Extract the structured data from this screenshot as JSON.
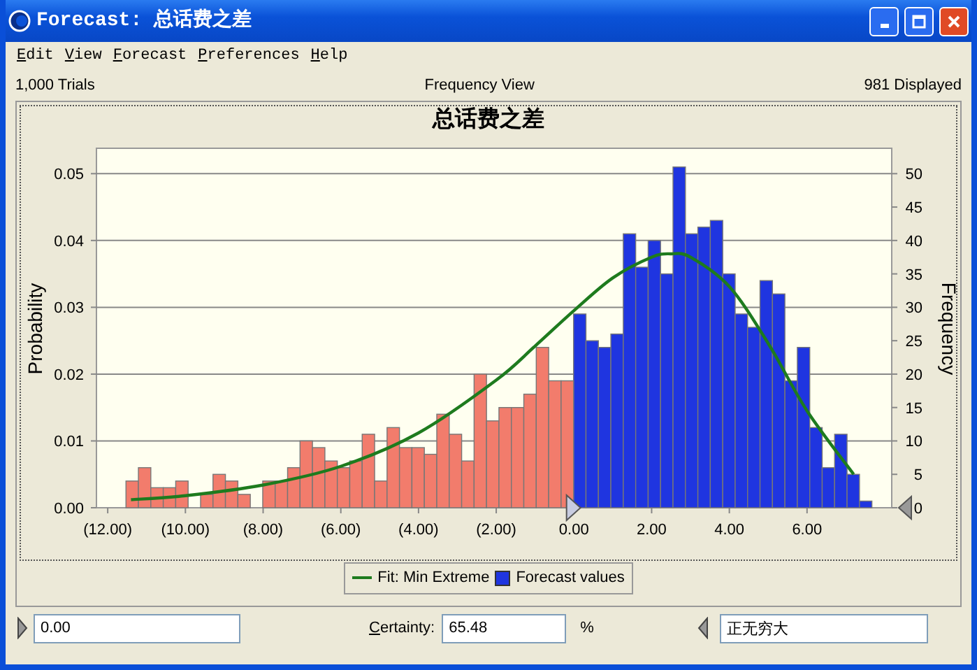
{
  "window": {
    "title": "Forecast: 总话费之差"
  },
  "menu": [
    {
      "label": "Edit"
    },
    {
      "label": "View"
    },
    {
      "label": "Forecast"
    },
    {
      "label": "Preferences"
    },
    {
      "label": "Help"
    }
  ],
  "info_bar": {
    "trials": "1,000 Trials",
    "view": "Frequency View",
    "displayed": "981 Displayed"
  },
  "chart": {
    "chart_data": {
      "type": "bar",
      "grid": true,
      "title": "总话费之差",
      "ylabel": "Probability",
      "y2label": "Frequency",
      "x": [
        -11.37,
        -11.05,
        -10.73,
        -10.41,
        -10.09,
        -9.77,
        -9.45,
        -9.13,
        -8.81,
        -8.49,
        -8.17,
        -7.85,
        -7.53,
        -7.21,
        -6.89,
        -6.57,
        -6.25,
        -5.93,
        -5.61,
        -5.29,
        -4.97,
        -4.65,
        -4.33,
        -4.01,
        -3.69,
        -3.37,
        -3.05,
        -2.73,
        -2.41,
        -2.09,
        -1.77,
        -1.45,
        -1.13,
        -0.81,
        -0.49,
        -0.17,
        0.15,
        0.47,
        0.79,
        1.11,
        1.43,
        1.75,
        2.07,
        2.39,
        2.71,
        3.03,
        3.35,
        3.67,
        3.99,
        4.31,
        4.63,
        4.95,
        5.27,
        5.59,
        5.91,
        6.23,
        6.55,
        6.87,
        7.19,
        7.51
      ],
      "series": [
        {
          "name": "Fit: Min Extreme",
          "type": "line",
          "color": "#1e7b1e",
          "x": [
            -11.4,
            -10,
            -8,
            -6,
            -4,
            -2,
            -1,
            0,
            1,
            2,
            2.5,
            3,
            4,
            5,
            6,
            7.2
          ],
          "values": [
            0.0012,
            0.0018,
            0.0034,
            0.0062,
            0.0112,
            0.0191,
            0.0242,
            0.0295,
            0.0344,
            0.0375,
            0.038,
            0.0375,
            0.0331,
            0.0246,
            0.0145,
            0.005
          ]
        },
        {
          "name": "Forecast values",
          "color": "#1f35e0",
          "values": [
            null,
            null,
            null,
            null,
            null,
            null,
            null,
            null,
            null,
            null,
            null,
            null,
            null,
            null,
            null,
            null,
            null,
            null,
            null,
            null,
            null,
            null,
            null,
            null,
            null,
            null,
            null,
            null,
            null,
            null,
            null,
            null,
            null,
            null,
            null,
            null,
            0.029,
            0.025,
            0.024,
            0.026,
            0.041,
            0.036,
            0.04,
            0.035,
            0.051,
            0.041,
            0.042,
            0.043,
            0.035,
            0.029,
            0.027,
            0.034,
            0.032,
            0.019,
            0.024,
            0.012,
            0.006,
            0.011,
            0.005,
            0.001
          ]
        },
        {
          "color": "#f27c6c",
          "values": [
            0.004,
            0.006,
            0.003,
            0.003,
            0.004,
            null,
            0.002,
            0.005,
            0.004,
            0.002,
            null,
            0.004,
            0.004,
            0.006,
            0.01,
            0.009,
            0.007,
            0.006,
            0.007,
            0.011,
            0.004,
            0.012,
            0.009,
            0.009,
            0.008,
            0.014,
            0.011,
            0.007,
            0.02,
            0.013,
            0.015,
            0.015,
            0.017,
            0.024,
            0.019,
            0.019,
            null,
            null,
            null,
            null,
            null,
            null,
            null,
            null,
            null,
            null,
            null,
            null,
            null,
            null,
            null,
            null,
            null,
            null,
            null,
            null,
            null,
            null,
            null,
            null
          ]
        }
      ],
      "xlim": [
        -12.29,
        8.18
      ],
      "ylim": [
        0,
        0.0538
      ],
      "y2lim": [
        0,
        53.8
      ],
      "xticks": [
        {
          "value": -12,
          "label": "(12.00)"
        },
        {
          "value": -10,
          "label": "(10.00)"
        },
        {
          "value": -8,
          "label": "(8.00)"
        },
        {
          "value": -6,
          "label": "(6.00)"
        },
        {
          "value": -4,
          "label": "(4.00)"
        },
        {
          "value": -2,
          "label": "(2.00)"
        },
        {
          "value": 0,
          "label": "0.00"
        },
        {
          "value": 2,
          "label": "2.00"
        },
        {
          "value": 4,
          "label": "4.00"
        },
        {
          "value": 6,
          "label": "6.00"
        }
      ],
      "yticks": [
        {
          "value": 0,
          "label": "0.00"
        },
        {
          "value": 0.01,
          "label": "0.01"
        },
        {
          "value": 0.02,
          "label": "0.02"
        },
        {
          "value": 0.03,
          "label": "0.03"
        },
        {
          "value": 0.04,
          "label": "0.04"
        },
        {
          "value": 0.05,
          "label": "0.05"
        }
      ],
      "y2ticks": [
        0,
        5,
        10,
        15,
        20,
        25,
        30,
        35,
        40,
        45,
        50
      ]
    }
  },
  "certainty_bar": {
    "lower": "0.00",
    "label": "Certainty:",
    "value": "65.48",
    "unit": "%",
    "upper": "正无穷大"
  }
}
